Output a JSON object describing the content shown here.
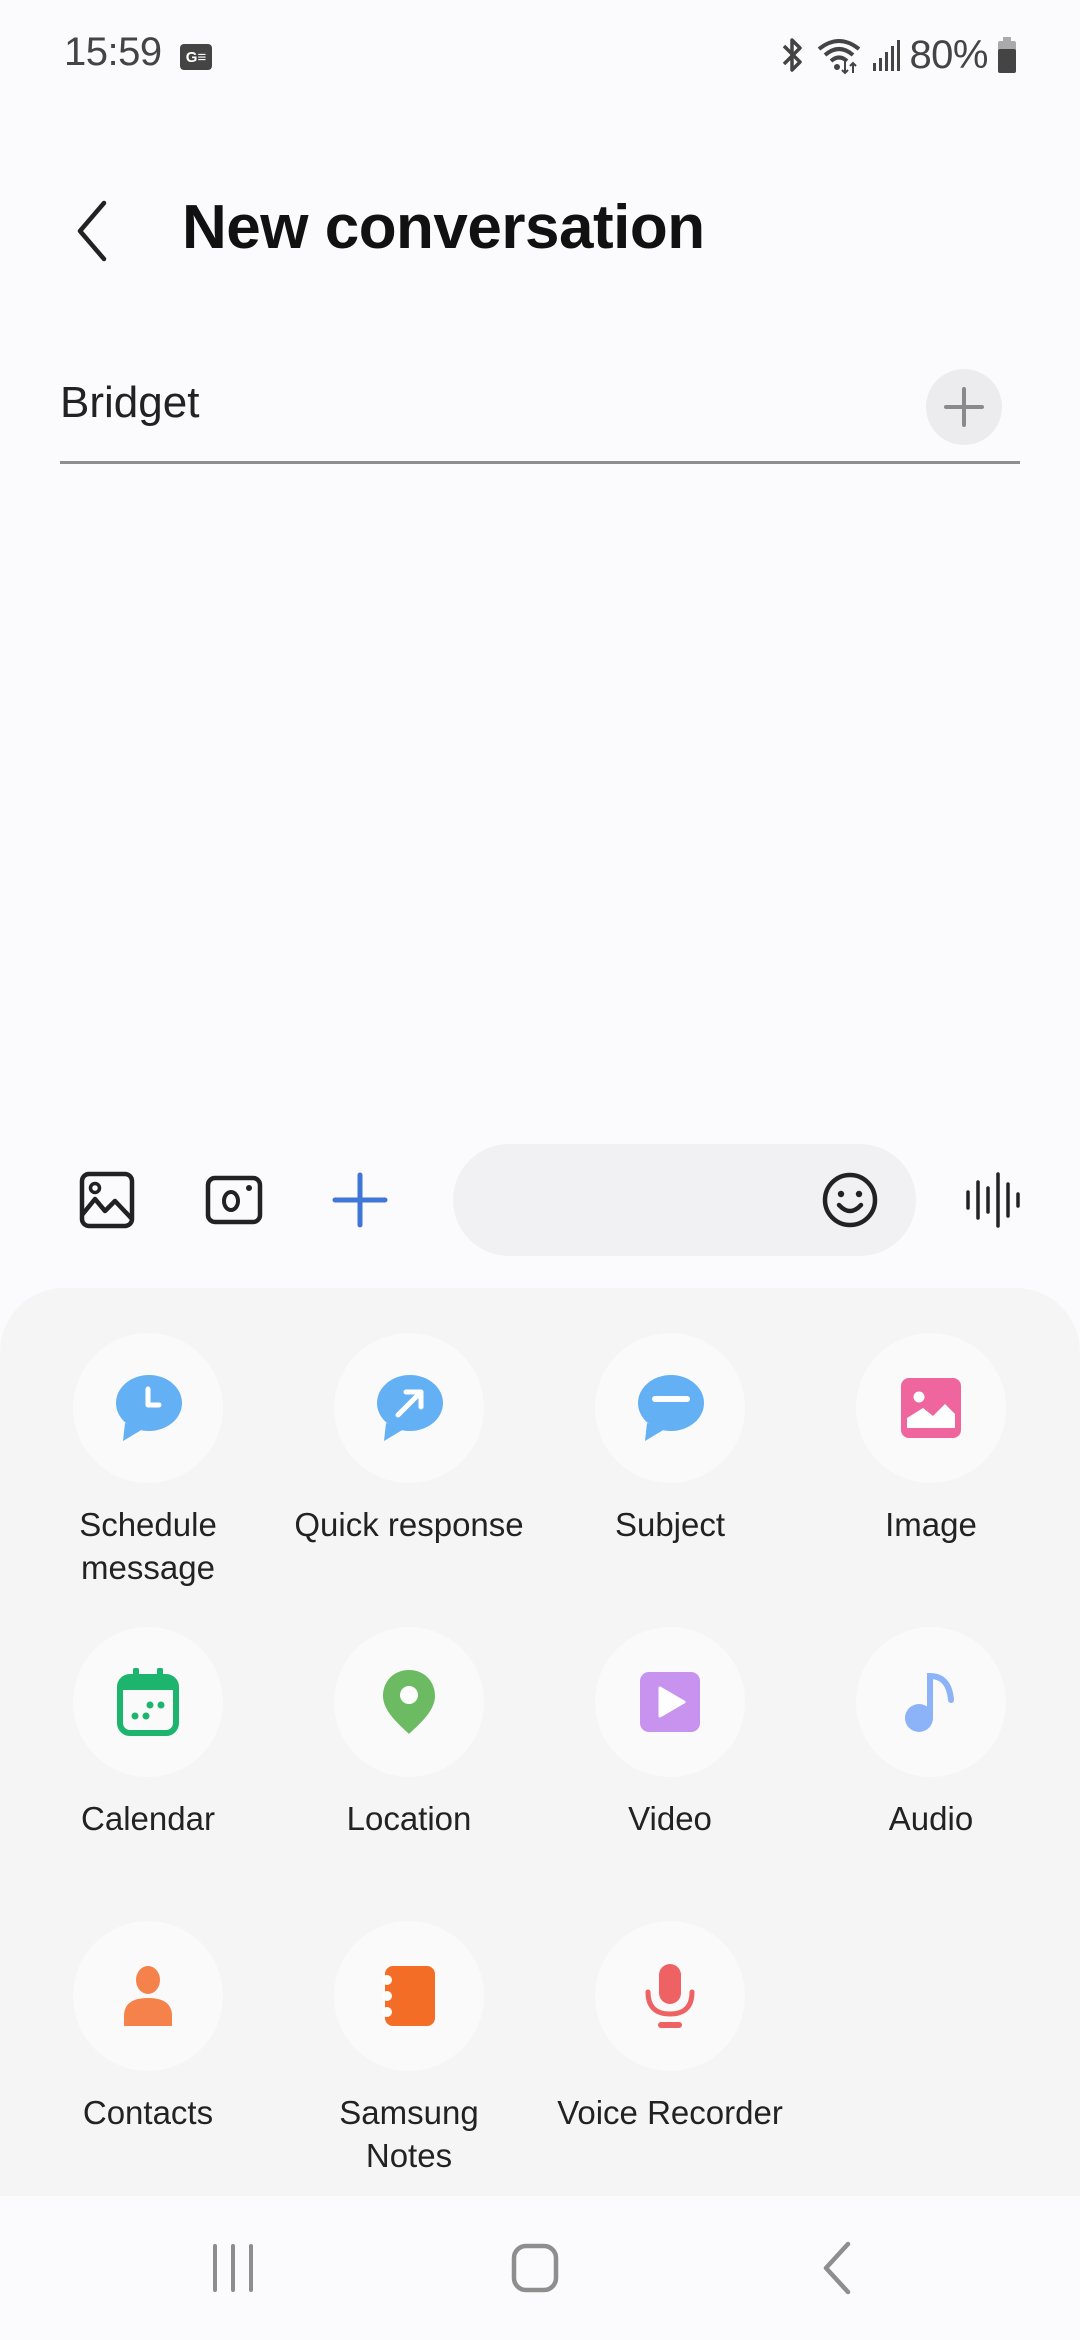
{
  "status_bar": {
    "time": "15:59",
    "notification_badge": "G≡",
    "icons": [
      "bluetooth-icon",
      "wifi-icon",
      "signal-icon",
      "battery-icon"
    ],
    "battery": "80%"
  },
  "header": {
    "back_icon": "chevron-left-icon",
    "title": "New conversation"
  },
  "recipient": {
    "value": "Bridget",
    "add_icon": "plus-icon"
  },
  "compose": {
    "gallery_icon": "image-icon",
    "camera_icon": "camera-icon",
    "more_icon": "plus-icon",
    "input_value": "",
    "input_placeholder": "",
    "emoji_icon": "emoji-icon",
    "voice_icon": "voice-waveform-icon"
  },
  "attachments": [
    {
      "label": "Schedule\nmessage",
      "icon": "schedule-message-icon",
      "color": "#64b0f5"
    },
    {
      "label": "Quick response",
      "icon": "quick-response-icon",
      "color": "#64b0f5"
    },
    {
      "label": "Subject",
      "icon": "subject-icon",
      "color": "#64b0f5"
    },
    {
      "label": "Image",
      "icon": "image-icon",
      "color": "#ef659d"
    },
    {
      "label": "Calendar",
      "icon": "calendar-icon",
      "color": "#1db56e"
    },
    {
      "label": "Location",
      "icon": "location-pin-icon",
      "color": "#6cbb62"
    },
    {
      "label": "Video",
      "icon": "video-icon",
      "color": "#c793ef"
    },
    {
      "label": "Audio",
      "icon": "music-note-icon",
      "color": "#8cb3f8"
    },
    {
      "label": "Contacts",
      "icon": "contact-person-icon",
      "color": "#f5824a"
    },
    {
      "label": "Samsung\nNotes",
      "icon": "notes-icon",
      "color": "#f46d26"
    },
    {
      "label": "Voice Recorder",
      "icon": "microphone-icon",
      "color": "#ef6263"
    }
  ],
  "nav_bar": {
    "recents": "recent-apps-icon",
    "home": "home-icon",
    "back": "back-icon"
  },
  "colors": {
    "accent": "#3f76d8",
    "panel_bg": "#f5f5f6",
    "background": "#fbfbfd"
  }
}
